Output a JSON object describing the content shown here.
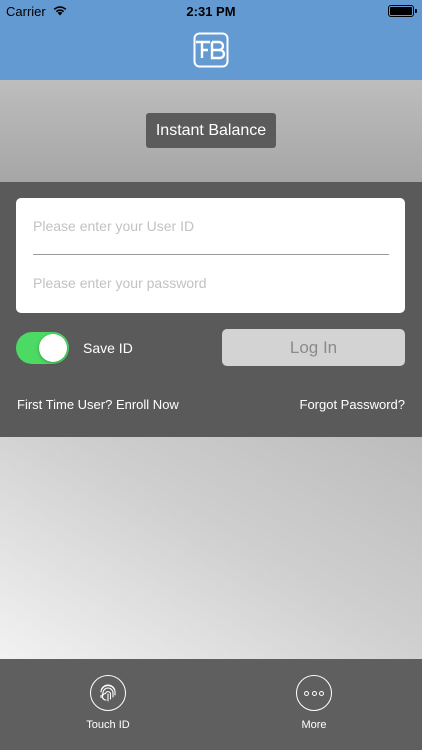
{
  "status_bar": {
    "carrier": "Carrier",
    "time": "2:31 PM",
    "wifi_icon": "wifi-icon",
    "battery_icon": "battery-icon"
  },
  "nav_bar": {
    "logo_icon": "fb-logo-icon",
    "background_color": "#639ad1"
  },
  "header": {
    "instant_balance_label": "Instant Balance"
  },
  "login": {
    "user_id_placeholder": "Please enter your User ID",
    "password_placeholder": "Please enter your password",
    "save_id_label": "Save ID",
    "save_id_checked": true,
    "login_label": "Log In",
    "enroll_label": "First Time User? Enroll Now",
    "forgot_label": "Forgot Password?"
  },
  "tab_bar": {
    "items": [
      {
        "label": "Touch ID",
        "icon": "fingerprint-icon"
      },
      {
        "label": "More",
        "icon": "more-dots-icon"
      }
    ]
  },
  "colors": {
    "accent": "#639ad1",
    "toggle_on": "#4cd964",
    "panel": "#5a5a5a"
  }
}
